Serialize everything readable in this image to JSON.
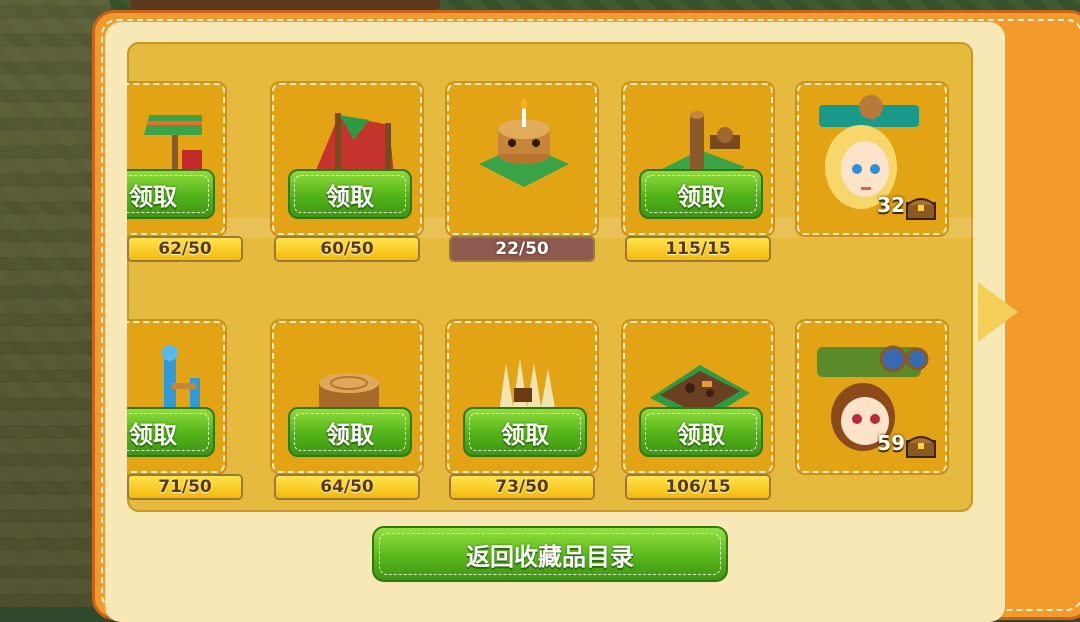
{
  "items_row1": [
    {
      "id": "item-1",
      "button": "领取",
      "progress": "62/50",
      "ratio": 1.0
    },
    {
      "id": "item-2",
      "button": "领取",
      "progress": "60/50",
      "ratio": 1.0
    },
    {
      "id": "item-3",
      "button": "",
      "progress": "22/50",
      "ratio": 0.44
    },
    {
      "id": "item-4",
      "button": "领取",
      "progress": "115/15",
      "ratio": 1.0
    }
  ],
  "items_row2": [
    {
      "id": "item-5",
      "button": "领取",
      "progress": "71/50",
      "ratio": 1.0
    },
    {
      "id": "item-6",
      "button": "领取",
      "progress": "64/50",
      "ratio": 1.0
    },
    {
      "id": "item-7",
      "button": "领取",
      "progress": "73/50",
      "ratio": 1.0
    },
    {
      "id": "item-8",
      "button": "领取",
      "progress": "106/15",
      "ratio": 1.0
    }
  ],
  "avatars": [
    {
      "name": "girl-avatar",
      "count": "32"
    },
    {
      "name": "boy-avatar",
      "count": "59"
    }
  ],
  "return_button": "返回收藏品目录",
  "colors": {
    "frame_orange": "#f39a2c",
    "gold_panel": "#e5ba3f",
    "button_green": "#58b81c",
    "side_panel_green": "#2fbf3b"
  }
}
